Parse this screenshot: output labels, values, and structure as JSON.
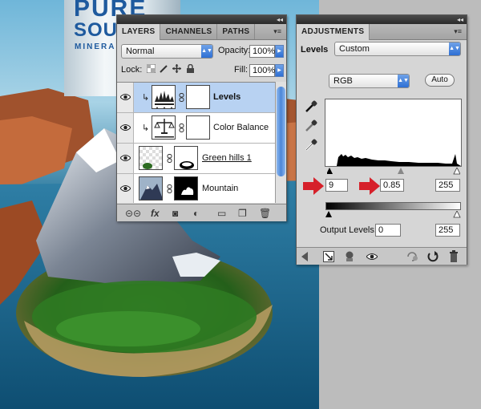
{
  "bottle": {
    "line1": "PURE",
    "line2": "SOU",
    "line3": "MINERA"
  },
  "layers_panel": {
    "tabs": [
      {
        "label": "LAYERS"
      },
      {
        "label": "CHANNELS"
      },
      {
        "label": "PATHS"
      }
    ],
    "window_controls": "◂◂",
    "tab_menu": "▾≡",
    "blend_mode": "Normal",
    "opacity_label": "Opacity:",
    "opacity_value": "100%",
    "lock_label": "Lock:",
    "fill_label": "Fill:",
    "fill_value": "100%",
    "layers": [
      {
        "name": "Levels",
        "selected": true
      },
      {
        "name": "Color Balance",
        "selected": false
      },
      {
        "name": "Green hills 1",
        "selected": false
      },
      {
        "name": "Mountain",
        "selected": false
      }
    ],
    "footer_icons": [
      {
        "name": "link-layers-icon",
        "glyph": "⊝⊝"
      },
      {
        "name": "layer-style-icon",
        "glyph": "fx"
      },
      {
        "name": "add-mask-icon",
        "glyph": "◙"
      },
      {
        "name": "new-adjustment-icon",
        "glyph": "◐"
      },
      {
        "name": "new-group-icon",
        "glyph": "▭"
      },
      {
        "name": "new-layer-icon",
        "glyph": "❐"
      },
      {
        "name": "trash-icon",
        "glyph": "🗑"
      }
    ]
  },
  "adjustments_panel": {
    "tab": "ADJUSTMENTS",
    "window_controls": "◂◂",
    "tab_menu": "▾≡",
    "adjustment_label": "Levels",
    "preset": "Custom",
    "channel": "RGB",
    "auto_label": "Auto",
    "input_black": "9",
    "input_gamma": "0.85",
    "input_white": "255",
    "output_label": "Output Levels:",
    "output_black": "0",
    "output_white": "255",
    "accent_color": "#d6202a"
  }
}
